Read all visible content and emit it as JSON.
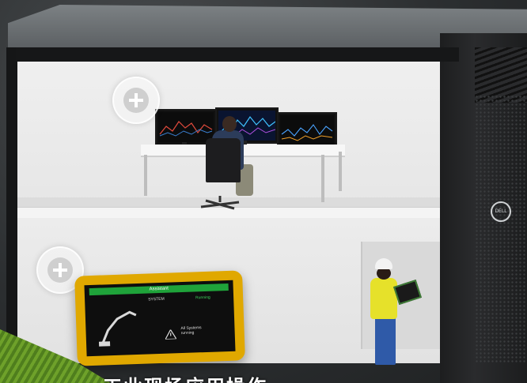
{
  "scene": {
    "hotspots": [
      {
        "name": "upper-hotspot"
      },
      {
        "name": "lower-hotspot"
      }
    ]
  },
  "tablet": {
    "header": "Assistant",
    "title": "SYSTEM",
    "status": "Running",
    "alert": "All Systems running"
  },
  "caption": "工业现场应用操作...",
  "colors": {
    "case": "#1d1e1f",
    "tablet_frame": "#e0a800",
    "status_green": "#1fa33a",
    "worker_vest": "#e6e12a"
  }
}
